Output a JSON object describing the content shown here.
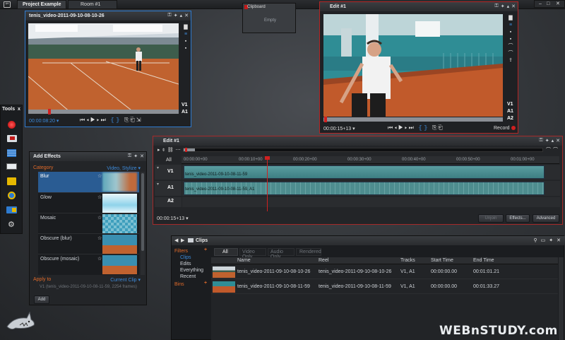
{
  "topbar": {
    "project": "Project Example",
    "room": "Room #1"
  },
  "source_monitor": {
    "title": "tenis_video-2011-09-10-08-10-26",
    "timecode": "00:00:08:20 ▾",
    "tracks": [
      "V1",
      "A1"
    ]
  },
  "clipboard": {
    "title": "Clipboard",
    "status": "Empty"
  },
  "edit_monitor": {
    "title": "Edit #1",
    "timecode": "00:00:15+13 ▾",
    "tracks": [
      "V1",
      "A1",
      "A2"
    ],
    "record_label": "Record"
  },
  "tools": {
    "title": "Tools",
    "close": "x"
  },
  "timeline": {
    "title": "Edit #1",
    "all_label": "All",
    "ruler": [
      "00:00:00+00",
      "00:00:10+00",
      "00:00:20+00",
      "00:00:30+00",
      "00:00:40+00",
      "00:00:50+00",
      "00:01:00+00"
    ],
    "tracks": [
      {
        "label": "V1",
        "clip": "tenis_video-2011-09-10-08-11-59"
      },
      {
        "label": "A1",
        "clip": "tenis_video-2011-09-10-08-11-59, A1"
      },
      {
        "label": "A2",
        "clip": ""
      }
    ],
    "timecode": "00:00:15+13 ▾",
    "unjoin": "Unjoin",
    "effects": "Effects...",
    "advanced": "Advanced"
  },
  "effects": {
    "title": "Add Effects",
    "category_label": "Category",
    "category_value": "Video, Stylize ▾",
    "items": [
      "Blur",
      "Glow",
      "Mosaic",
      "Obscure (blur)",
      "Obscure (mosaic)"
    ],
    "apply_to_label": "Apply to",
    "apply_to_value": "Current Clip ▾",
    "clip_info": "V1 (tenis_video-2011-09-10-08-11-59, 2254 frames)",
    "add_button": "Add"
  },
  "clips": {
    "title": "Clips",
    "filters_label": "Filters",
    "filters": [
      "Clips",
      "Edits",
      "Everything",
      "Recent"
    ],
    "bins_label": "Bins",
    "tabs": [
      "All",
      "Video Only",
      "Audio Only",
      "Rendered"
    ],
    "columns": [
      "Name",
      "Reel",
      "Tracks",
      "Start Time",
      "End Time"
    ],
    "rows": [
      {
        "name": "tenis_video-2011-09-10-08-10-26",
        "reel": "tenis_video-2011-09-10-08-10-26",
        "tracks": "V1, A1",
        "start": "00:00:00.00",
        "end": "00:01:01.21"
      },
      {
        "name": "tenis_video-2011-09-10-08-11-59",
        "reel": "tenis_video-2011-09-10-08-11-59",
        "tracks": "V1, A1",
        "start": "00:00:00.00",
        "end": "00:01:33.27"
      }
    ]
  },
  "watermark": "WEBnSTUDY.com",
  "colors": {
    "accent_blue": "#2f7fd1",
    "accent_red": "#c21a1a",
    "clay": "#b5552d",
    "track_teal": "#4e8d8f"
  }
}
